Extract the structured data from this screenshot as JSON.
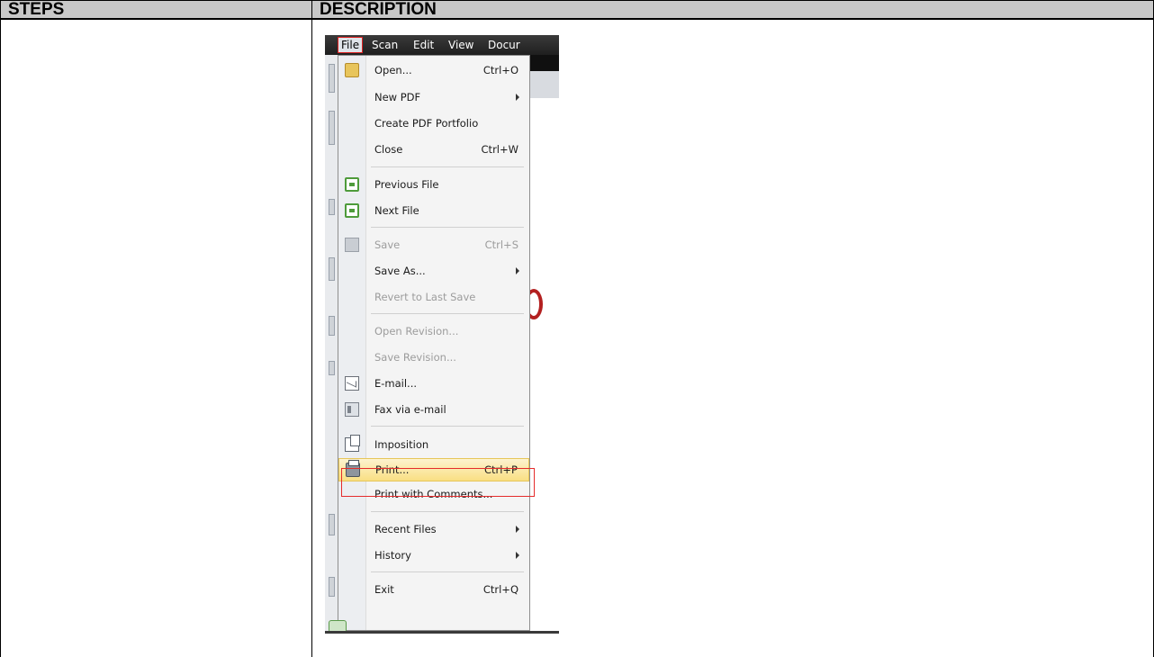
{
  "table": {
    "header_steps": "STEPS",
    "header_description": "DESCRIPTION"
  },
  "menubar": {
    "items": [
      "File",
      "Scan",
      "Edit",
      "View",
      "Docur"
    ],
    "active_item": "File"
  },
  "menu": {
    "items": [
      {
        "label": "Open...",
        "shortcut": "Ctrl+O",
        "icon": "folder-icon"
      },
      {
        "label": "New PDF",
        "submenu": true
      },
      {
        "label": "Create PDF Portfolio"
      },
      {
        "label": "Close",
        "shortcut": "Ctrl+W"
      },
      {
        "label": "Previous File",
        "icon": "previous-file-icon"
      },
      {
        "label": "Next File",
        "icon": "next-file-icon"
      },
      {
        "label": "Save",
        "shortcut": "Ctrl+S",
        "disabled": true,
        "icon": "save-icon"
      },
      {
        "label": "Save As...",
        "submenu": true
      },
      {
        "label": "Revert to Last Save",
        "disabled": true
      },
      {
        "label": "Open Revision...",
        "disabled": true
      },
      {
        "label": "Save Revision...",
        "disabled": true
      },
      {
        "label": "E-mail...",
        "icon": "email-icon"
      },
      {
        "label": "Fax via e-mail",
        "icon": "fax-icon"
      },
      {
        "label": "Imposition",
        "icon": "imposition-icon"
      },
      {
        "label": "Print...",
        "shortcut": "Ctrl+P",
        "highlighted": true,
        "icon": "printer-icon"
      },
      {
        "label": "Print with Comments..."
      },
      {
        "label": "Recent Files",
        "submenu": true
      },
      {
        "label": "History",
        "submenu": true
      },
      {
        "label": "Exit",
        "shortcut": "Ctrl+Q"
      }
    ]
  },
  "colors": {
    "header_bg": "#c8c8c8",
    "highlight_frame": "#e52c2c",
    "menu_highlight": "#f9df83"
  }
}
